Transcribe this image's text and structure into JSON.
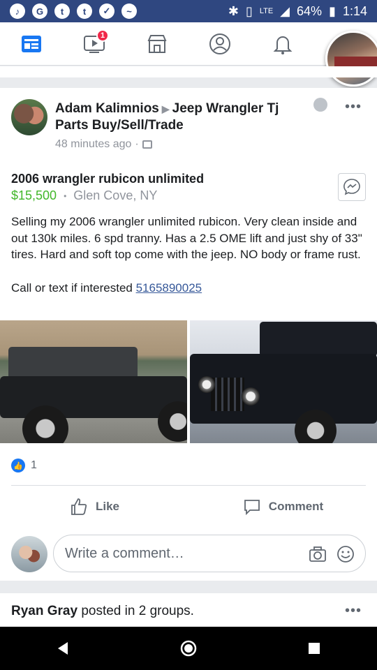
{
  "status_bar": {
    "battery": "64%",
    "time": "1:14",
    "network": "LTE"
  },
  "nav": {
    "video_badge": "1"
  },
  "post": {
    "author": "Adam Kalimnios",
    "group": "Jeep Wrangler Tj Parts Buy/Sell/Trade",
    "time": "48 minutes ago",
    "item_title": "2006 wrangler rubicon unlimited",
    "price": "$15,500",
    "location": "Glen Cove, NY",
    "body": "Selling my 2006 wrangler unlimited rubicon. Very clean inside and out 130k miles. 6 spd tranny. Has a 2.5 OME lift and just shy of 33\" tires. Hard and soft top come with the jeep. NO body or frame rust.",
    "call_text": "Call or text if interested ",
    "phone": "5165890025",
    "like_count": "1"
  },
  "actions": {
    "like": "Like",
    "comment": "Comment"
  },
  "comment_box": {
    "placeholder": "Write a comment…"
  },
  "next_post": {
    "author": "Ryan Gray",
    "suffix": " posted in 2 groups."
  },
  "colors": {
    "facebook_blue": "#2f4780",
    "accent": "#1877f2",
    "price_green": "#42b72a",
    "link": "#365899"
  },
  "icons": [
    "news-feed-icon",
    "video-icon",
    "marketplace-icon",
    "profile-icon",
    "notifications-icon",
    "messenger-icon",
    "like-icon",
    "comment-icon",
    "camera-icon",
    "emoji-icon",
    "back-icon",
    "home-icon",
    "recents-icon"
  ]
}
